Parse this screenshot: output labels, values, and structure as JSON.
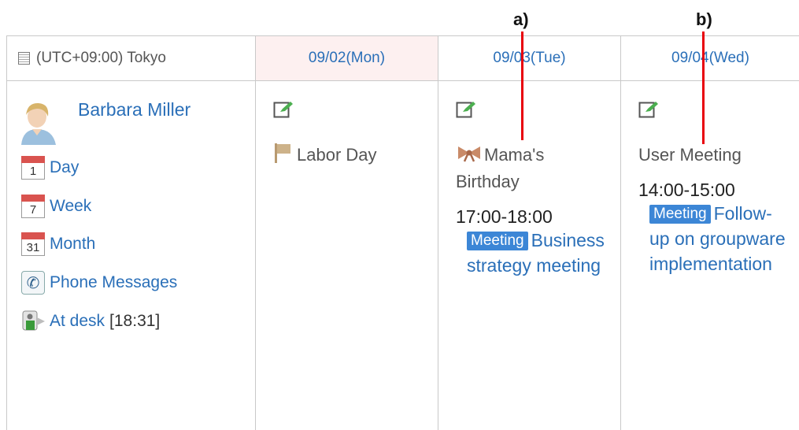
{
  "annotations": {
    "a": "a)",
    "b": "b)"
  },
  "header": {
    "timezone": "(UTC+09:00) Tokyo",
    "days": [
      "09/02(Mon)",
      "09/03(Tue)",
      "09/04(Wed)"
    ]
  },
  "user": {
    "name": "Barbara Miller",
    "links": {
      "day": "Day",
      "week": "Week",
      "month": "Month",
      "phone": "Phone Messages",
      "at_desk": "At desk",
      "at_desk_time": "[18:31]"
    },
    "icon_numbers": {
      "day": "1",
      "week": "7",
      "month": "31"
    }
  },
  "days": {
    "mon": {
      "holiday": "Labor Day"
    },
    "tue": {
      "anniversary": "Mama's Birthday",
      "time": "17:00-18:00",
      "badge": "Meeting",
      "title": "Business strategy meeting"
    },
    "wed": {
      "event": "User Meeting",
      "time": "14:00-15:00",
      "badge": "Meeting",
      "title": "Follow-up on groupware implementation"
    }
  },
  "colors": {
    "link": "#2a6fb8",
    "badge": "#3c86d6",
    "today_header": "#fdf0f0",
    "callout_line": "#e8000b"
  },
  "icons": [
    "timezone-icon",
    "avatar",
    "day-calendar-icon",
    "week-calendar-icon",
    "month-calendar-icon",
    "phone-icon",
    "at-desk-icon",
    "add-schedule-icon",
    "flag-icon",
    "bow-icon"
  ]
}
